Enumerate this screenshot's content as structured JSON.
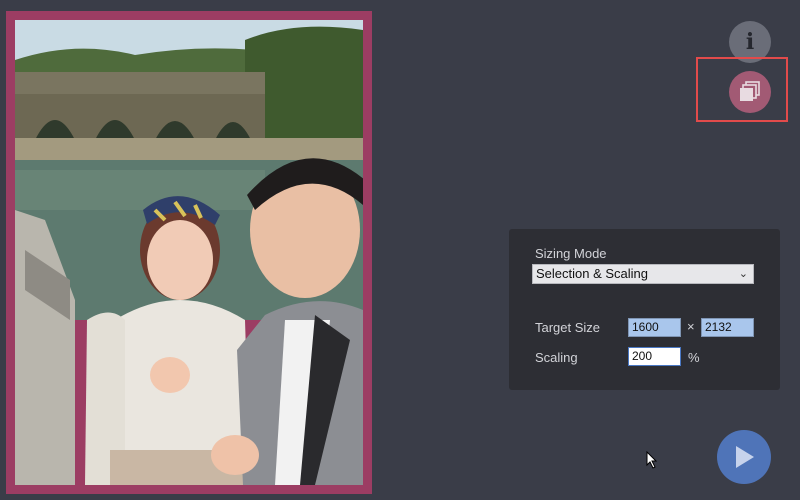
{
  "toolbar": {
    "info_icon": "info-icon",
    "batch_icon": "stacked-images-icon",
    "highlight_color": "#e24b4b"
  },
  "sizing_panel": {
    "mode_label": "Sizing Mode",
    "mode_value": "Selection & Scaling",
    "target_size_label": "Target Size",
    "target_width": "1600",
    "times_symbol": "×",
    "target_height": "2132",
    "scaling_label": "Scaling",
    "scaling_value": "200",
    "scaling_unit": "%"
  },
  "actions": {
    "run_icon": "play-icon"
  },
  "colors": {
    "background": "#3a3d48",
    "frame": "#9c3d63",
    "panel": "#2d2e34",
    "play": "#4f74b8"
  }
}
